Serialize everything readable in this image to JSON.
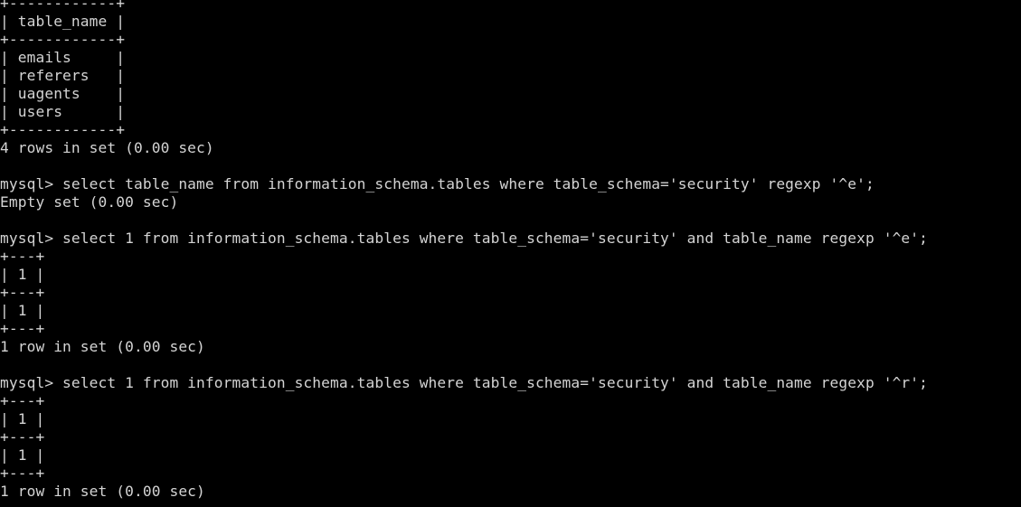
{
  "terminal": {
    "app": "mysql-client-terminal",
    "colors": {
      "background": "#000000",
      "foreground": "#d4d4d4"
    },
    "prompt": "mysql>",
    "lines": [
      "+------------+",
      "| table_name |",
      "+------------+",
      "| emails     |",
      "| referers   |",
      "| uagents    |",
      "| users      |",
      "+------------+",
      "4 rows in set (0.00 sec)",
      "",
      "mysql> select table_name from information_schema.tables where table_schema='security' regexp '^e';",
      "Empty set (0.00 sec)",
      "",
      "mysql> select 1 from information_schema.tables where table_schema='security' and table_name regexp '^e';",
      "+---+",
      "| 1 |",
      "+---+",
      "| 1 |",
      "+---+",
      "1 row in set (0.00 sec)",
      "",
      "mysql> select 1 from information_schema.tables where table_schema='security' and table_name regexp '^r';",
      "+---+",
      "| 1 |",
      "+---+",
      "| 1 |",
      "+---+",
      "1 row in set (0.00 sec)"
    ],
    "result_tables": [
      {
        "name": "table-name-result",
        "columns": [
          "table_name"
        ],
        "rows": [
          [
            "emails"
          ],
          [
            "referers"
          ],
          [
            "uagents"
          ],
          [
            "users"
          ]
        ],
        "status": "4 rows in set (0.00 sec)"
      },
      {
        "name": "regexp-e-result",
        "columns": [
          "1"
        ],
        "rows": [
          [
            "1"
          ]
        ],
        "status": "1 row in set (0.00 sec)"
      },
      {
        "name": "regexp-r-result",
        "columns": [
          "1"
        ],
        "rows": [
          [
            "1"
          ]
        ],
        "status": "1 row in set (0.00 sec)"
      }
    ],
    "commands": [
      {
        "prompt": "mysql>",
        "sql": "select table_name from information_schema.tables where table_schema='security' regexp '^e';",
        "result": "Empty set (0.00 sec)"
      },
      {
        "prompt": "mysql>",
        "sql": "select 1 from information_schema.tables where table_schema='security' and table_name regexp '^e';",
        "result": "1 row in set (0.00 sec)"
      },
      {
        "prompt": "mysql>",
        "sql": "select 1 from information_schema.tables where table_schema='security' and table_name regexp '^r';",
        "result": "1 row in set (0.00 sec)"
      }
    ]
  }
}
